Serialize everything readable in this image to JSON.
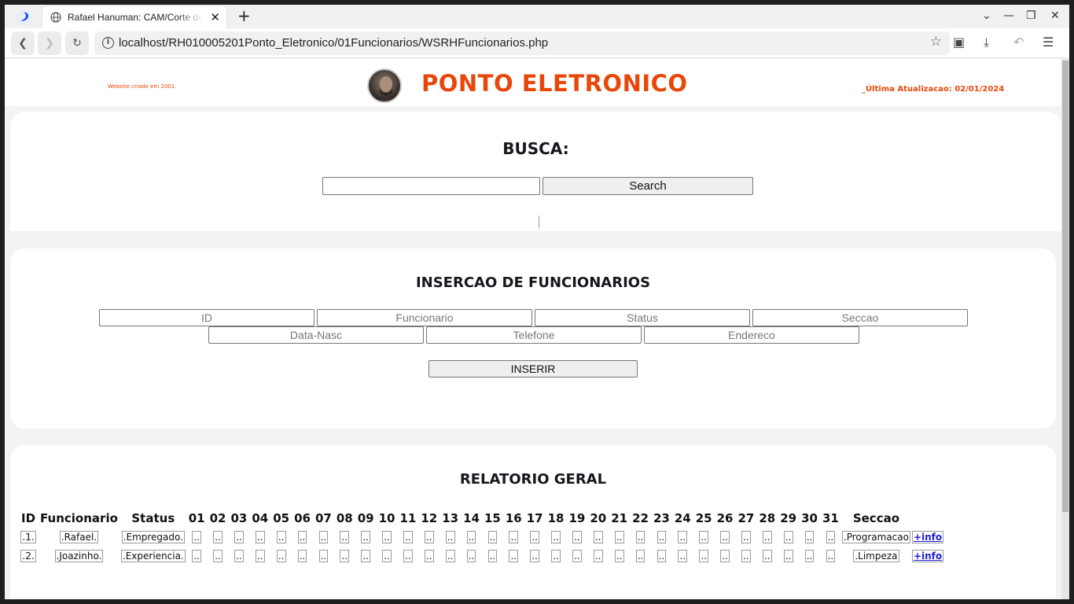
{
  "browser": {
    "tab_title": "Rafael Hanuman: CAM/Corte de M",
    "url": "localhost/RH010005201Ponto_Eletronico/01Funcionarios/WSRHFuncionarios.php"
  },
  "header": {
    "created_note": "Website criado em 2001.",
    "brand": "PONTO ELETRONICO",
    "updated": "_Última Atualizacao: 02/01/2024"
  },
  "search": {
    "title": "BUSCA:",
    "input_value": "",
    "button": "Search"
  },
  "insert": {
    "title": "INSERCAO DE FUNCIONARIOS",
    "fields_row1": [
      "ID",
      "Funcionario",
      "Status",
      "Seccao"
    ],
    "fields_row2": [
      "Data-Nasc",
      "Telefone",
      "Endereco"
    ],
    "button": "INSERIR"
  },
  "report": {
    "title": "RELATORIO GERAL",
    "headers": [
      "ID",
      "Funcionario",
      "Status",
      "01",
      "02",
      "03",
      "04",
      "05",
      "06",
      "07",
      "08",
      "09",
      "10",
      "11",
      "12",
      "13",
      "14",
      "15",
      "16",
      "17",
      "18",
      "19",
      "20",
      "21",
      "22",
      "23",
      "24",
      "25",
      "26",
      "27",
      "28",
      "29",
      "30",
      "31",
      "Seccao",
      ""
    ],
    "rows": [
      {
        "id": ".1.",
        "name": ".Rafael.",
        "status": ".Empregado.",
        "days": [
          "..",
          "..",
          "..",
          "..",
          "..",
          "..",
          "..",
          "..",
          "..",
          "..",
          "..",
          "..",
          "..",
          "..",
          "..",
          "..",
          "..",
          "..",
          "..",
          "..",
          "..",
          "..",
          "..",
          "..",
          "..",
          "..",
          "..",
          "..",
          "..",
          "..",
          ".."
        ],
        "section": ".Programacao",
        "more": "+info"
      },
      {
        "id": ".2.",
        "name": ".Joazinho.",
        "status": ".Experiencia.",
        "days": [
          "..",
          "..",
          "..",
          "..",
          "..",
          "..",
          "..",
          "..",
          "..",
          "..",
          "..",
          "..",
          "..",
          "..",
          "..",
          "..",
          "..",
          "..",
          "..",
          "..",
          "..",
          "..",
          "..",
          "..",
          "..",
          "..",
          "..",
          "..",
          "..",
          "..",
          ".."
        ],
        "section": ".Limpeza",
        "more": "+info"
      }
    ]
  }
}
